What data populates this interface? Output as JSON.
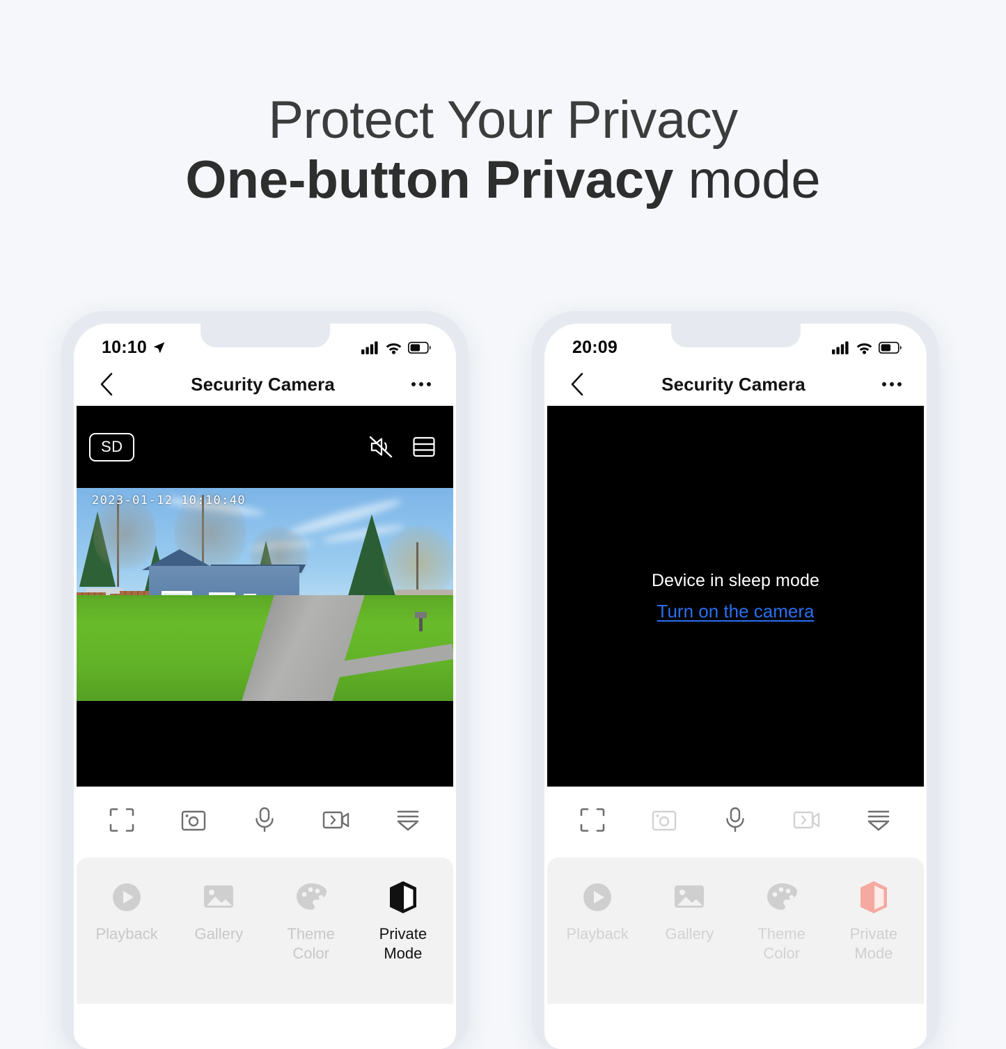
{
  "headline": {
    "line1": "Protect Your Privacy",
    "line2_strong": "One-button Privacy",
    "line2_light": " mode"
  },
  "colors": {
    "background": "#f5f7fa",
    "phone_frame": "#e6eaf0",
    "link_blue": "#2a6ff0",
    "private_mode_active": "#111111",
    "private_mode_pink": "#f5a9a0",
    "panel_bg": "#f2f2f2"
  },
  "phones": [
    {
      "id": "phone-live",
      "status": {
        "time": "10:10",
        "location_icon": "location-arrow-icon",
        "signal_icon": "cellular-signal-icon",
        "wifi_icon": "wifi-icon",
        "battery_icon": "battery-icon"
      },
      "nav": {
        "back_icon": "chevron-left-icon",
        "title": "Security Camera",
        "more_icon": "more-horizontal-icon"
      },
      "video": {
        "state": "live",
        "quality_badge": "SD",
        "mute_icon": "speaker-muted-icon",
        "layout_icon": "split-view-icon",
        "timestamp": "2023-01-12 10:10:40"
      },
      "controls": [
        {
          "name": "fullscreen",
          "icon": "fullscreen-icon",
          "disabled": false
        },
        {
          "name": "snapshot",
          "icon": "camera-snapshot-icon",
          "disabled": false
        },
        {
          "name": "microphone",
          "icon": "microphone-icon",
          "disabled": false
        },
        {
          "name": "record",
          "icon": "video-record-icon",
          "disabled": false
        },
        {
          "name": "more",
          "icon": "expand-more-icon",
          "disabled": false
        }
      ],
      "features": [
        {
          "label": "Playback",
          "icon": "play-circle-icon",
          "active": false
        },
        {
          "label": "Gallery",
          "icon": "gallery-image-icon",
          "active": false
        },
        {
          "label": "Theme\nColor",
          "icon": "palette-icon",
          "active": false
        },
        {
          "label": "Private\nMode",
          "icon": "private-mode-shield-icon",
          "active": true
        }
      ]
    },
    {
      "id": "phone-sleep",
      "status": {
        "time": "20:09",
        "location_icon": "",
        "signal_icon": "cellular-signal-icon",
        "wifi_icon": "wifi-icon",
        "battery_icon": "battery-icon"
      },
      "nav": {
        "back_icon": "chevron-left-icon",
        "title": "Security Camera",
        "more_icon": "more-horizontal-icon"
      },
      "video": {
        "state": "sleep",
        "sleep_text": "Device in sleep mode",
        "sleep_link": "Turn on the camera"
      },
      "controls": [
        {
          "name": "fullscreen",
          "icon": "fullscreen-icon",
          "disabled": false
        },
        {
          "name": "snapshot",
          "icon": "camera-snapshot-icon",
          "disabled": true
        },
        {
          "name": "microphone",
          "icon": "microphone-icon",
          "disabled": false
        },
        {
          "name": "record",
          "icon": "video-record-icon",
          "disabled": true
        },
        {
          "name": "more",
          "icon": "expand-more-icon",
          "disabled": false
        }
      ],
      "features": [
        {
          "label": "Playback",
          "icon": "play-circle-icon",
          "active": false
        },
        {
          "label": "Gallery",
          "icon": "gallery-image-icon",
          "active": false
        },
        {
          "label": "Theme\nColor",
          "icon": "palette-icon",
          "active": false
        },
        {
          "label": "Private\nMode",
          "icon": "private-mode-shield-icon",
          "active": true
        }
      ]
    }
  ]
}
